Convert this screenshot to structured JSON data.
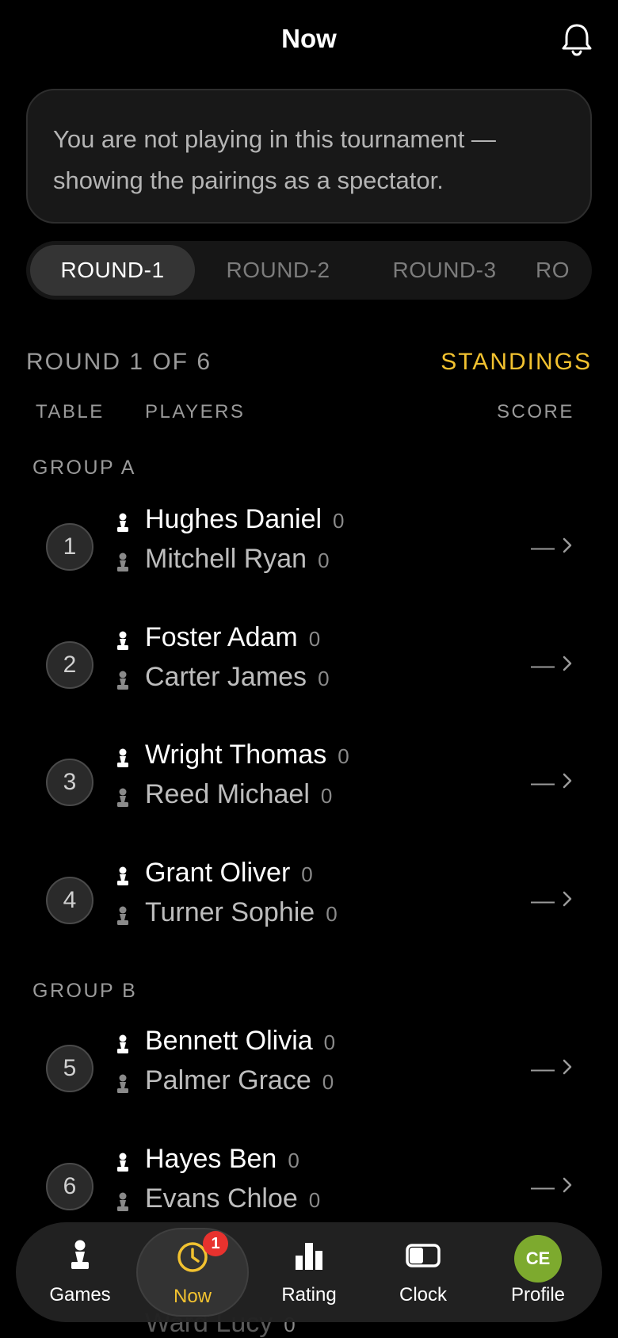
{
  "header": {
    "title": "Now",
    "bell_icon": "bell-icon"
  },
  "notice": {
    "text": "You are not playing in this tournament — showing the pairings as a spectator."
  },
  "round_tabs": [
    {
      "label": "ROUND-1",
      "active": true
    },
    {
      "label": "ROUND-2",
      "active": false
    },
    {
      "label": "ROUND-3",
      "active": false
    },
    {
      "label": "RO",
      "active": false
    }
  ],
  "round_info": {
    "label": "ROUND 1 OF 6",
    "standings_link": "STANDINGS"
  },
  "columns": {
    "table": "TABLE",
    "players": "PLAYERS",
    "score": "SCORE"
  },
  "groups": [
    {
      "label": "GROUP A",
      "pairings": [
        {
          "table": "1",
          "white": "Hughes Daniel",
          "white_score": "0",
          "black": "Mitchell Ryan",
          "black_score": "0",
          "result": "—"
        },
        {
          "table": "2",
          "white": "Foster Adam",
          "white_score": "0",
          "black": "Carter James",
          "black_score": "0",
          "result": "—"
        },
        {
          "table": "3",
          "white": "Wright Thomas",
          "white_score": "0",
          "black": "Reed Michael",
          "black_score": "0",
          "result": "—"
        },
        {
          "table": "4",
          "white": "Grant Oliver",
          "white_score": "0",
          "black": "Turner Sophie",
          "black_score": "0",
          "result": "—"
        }
      ]
    },
    {
      "label": "GROUP B",
      "pairings": [
        {
          "table": "5",
          "white": "Bennett Olivia",
          "white_score": "0",
          "black": "Palmer Grace",
          "black_score": "0",
          "result": "—"
        },
        {
          "table": "6",
          "white": "Hayes Ben",
          "white_score": "0",
          "black": "Evans Chloe",
          "black_score": "0",
          "result": "—"
        }
      ]
    }
  ],
  "partial_next_row": {
    "black": "Ward Lucy",
    "black_score": "0"
  },
  "tabbar": {
    "items": [
      {
        "label": "Games",
        "icon": "pawn-icon"
      },
      {
        "label": "Now",
        "icon": "clock-icon",
        "badge": "1",
        "active": true
      },
      {
        "label": "Rating",
        "icon": "bar-chart-icon"
      },
      {
        "label": "Clock",
        "icon": "chess-clock-icon"
      },
      {
        "label": "Profile",
        "avatar_initials": "CE"
      }
    ]
  },
  "colors": {
    "accent": "#f2c230",
    "badge": "#e8322e",
    "avatar": "#7daa2e"
  }
}
